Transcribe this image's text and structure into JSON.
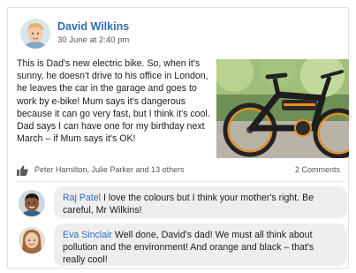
{
  "post": {
    "author": "David Wilkins",
    "timestamp": "30 June at 2:40 pm",
    "text": "This is Dad's new electric bike. So, when it's sunny, he doesn't drive to his office in London, he leaves the car in the garage and goes to work by e-bike! Mum says it's dangerous because it can go very fast, but I think it's cool. Dad says I can have one for my birthday next March – if Mum says it's OK!",
    "photo_icon": "electric-bike-photo",
    "likes_text": "Peter Hamilton, Julie Parker and 13 others",
    "comments_count": "2 Comments"
  },
  "comments": [
    {
      "name": "Raj Patel",
      "text": "I love the colours but I think your mother's right. Be careful, Mr Wilkins!"
    },
    {
      "name": "Eva Sinclair",
      "text": "Well done, David's dad! We must all think about pollution and the environment! And orange and black – that's really cool!"
    }
  ],
  "colors": {
    "name_link": "#2f6fb6",
    "bubble_bg": "#eeeeee",
    "bike_orange": "#f08a1c"
  }
}
